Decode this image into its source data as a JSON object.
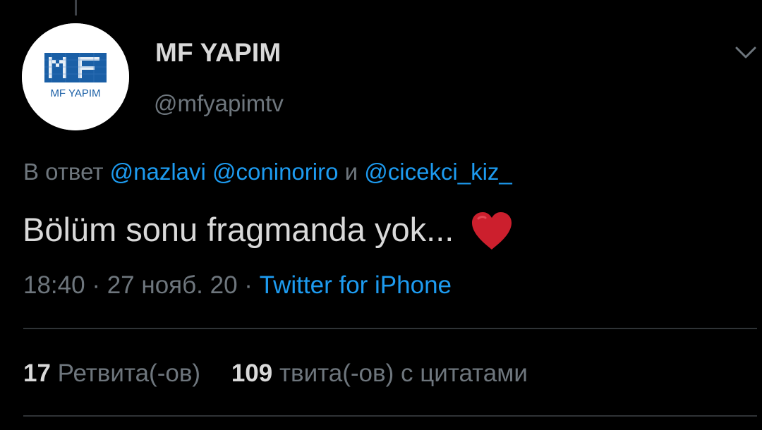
{
  "tweet": {
    "author": {
      "display_name": "MF YAPIM",
      "username": "@mfyapimtv",
      "avatar_logo_text": "MF YAPIM"
    },
    "reply_to": {
      "prefix": "В ответ",
      "mentions": [
        "@nazlavi",
        "@coninoriro"
      ],
      "conjunction": "и",
      "last_mention": "@cicekci_kiz_"
    },
    "text": "Bölüm sonu fragmanda yok...",
    "emoji": "red-heart",
    "time": "18:40",
    "separator": "·",
    "date": "27 нояб. 20",
    "source": "Twitter for iPhone",
    "stats": {
      "retweets_count": "17",
      "retweets_label": "Ретвита(-ов)",
      "quotes_count": "109",
      "quotes_label": "твита(-ов) с цитатами"
    }
  },
  "colors": {
    "background": "#000000",
    "text_primary": "#d9d9d9",
    "text_secondary": "#6e767d",
    "link": "#1d9bf0",
    "heart": "#e0245e",
    "logo_blue": "#1a5fa6"
  },
  "icons": {
    "menu": "chevron-down-icon",
    "heart": "heart-icon"
  }
}
